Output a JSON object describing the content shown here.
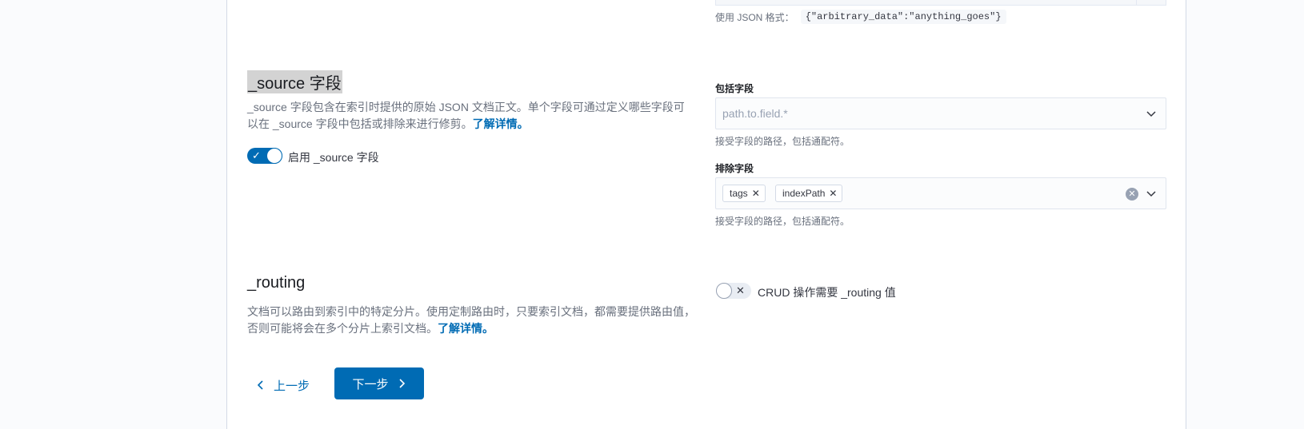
{
  "prev_field": {
    "help_prefix": "使用 JSON 格式：",
    "help_code": "{\"arbitrary_data\":\"anything_goes\"}"
  },
  "source_section": {
    "title": "_source 字段",
    "description": "_source 字段包含在索引时提供的原始 JSON 文档正文。单个字段可通过定义哪些字段可以在 _source 字段中包括或排除来进行修剪。",
    "learn_more": "了解详情。",
    "toggle": {
      "label": "启用 _source 字段",
      "enabled": true
    },
    "include": {
      "label": "包括字段",
      "placeholder": "path.to.field.*",
      "help": "接受字段的路径，包括通配符。"
    },
    "exclude": {
      "label": "排除字段",
      "values": [
        "tags",
        "indexPath"
      ],
      "help": "接受字段的路径，包括通配符。"
    }
  },
  "routing_section": {
    "title": "_routing",
    "description": "文档可以路由到索引中的特定分片。使用定制路由时，只要索引文档，都需要提供路由值，否则可能将会在多个分片上索引文档。",
    "learn_more": "了解详情。",
    "toggle": {
      "label": "CRUD 操作需要 _routing 值",
      "enabled": false
    }
  },
  "nav": {
    "back_label": "上一步",
    "next_label": "下一步"
  },
  "colors": {
    "primary": "#006bb4",
    "text": "#343741",
    "muted": "#69707d"
  }
}
